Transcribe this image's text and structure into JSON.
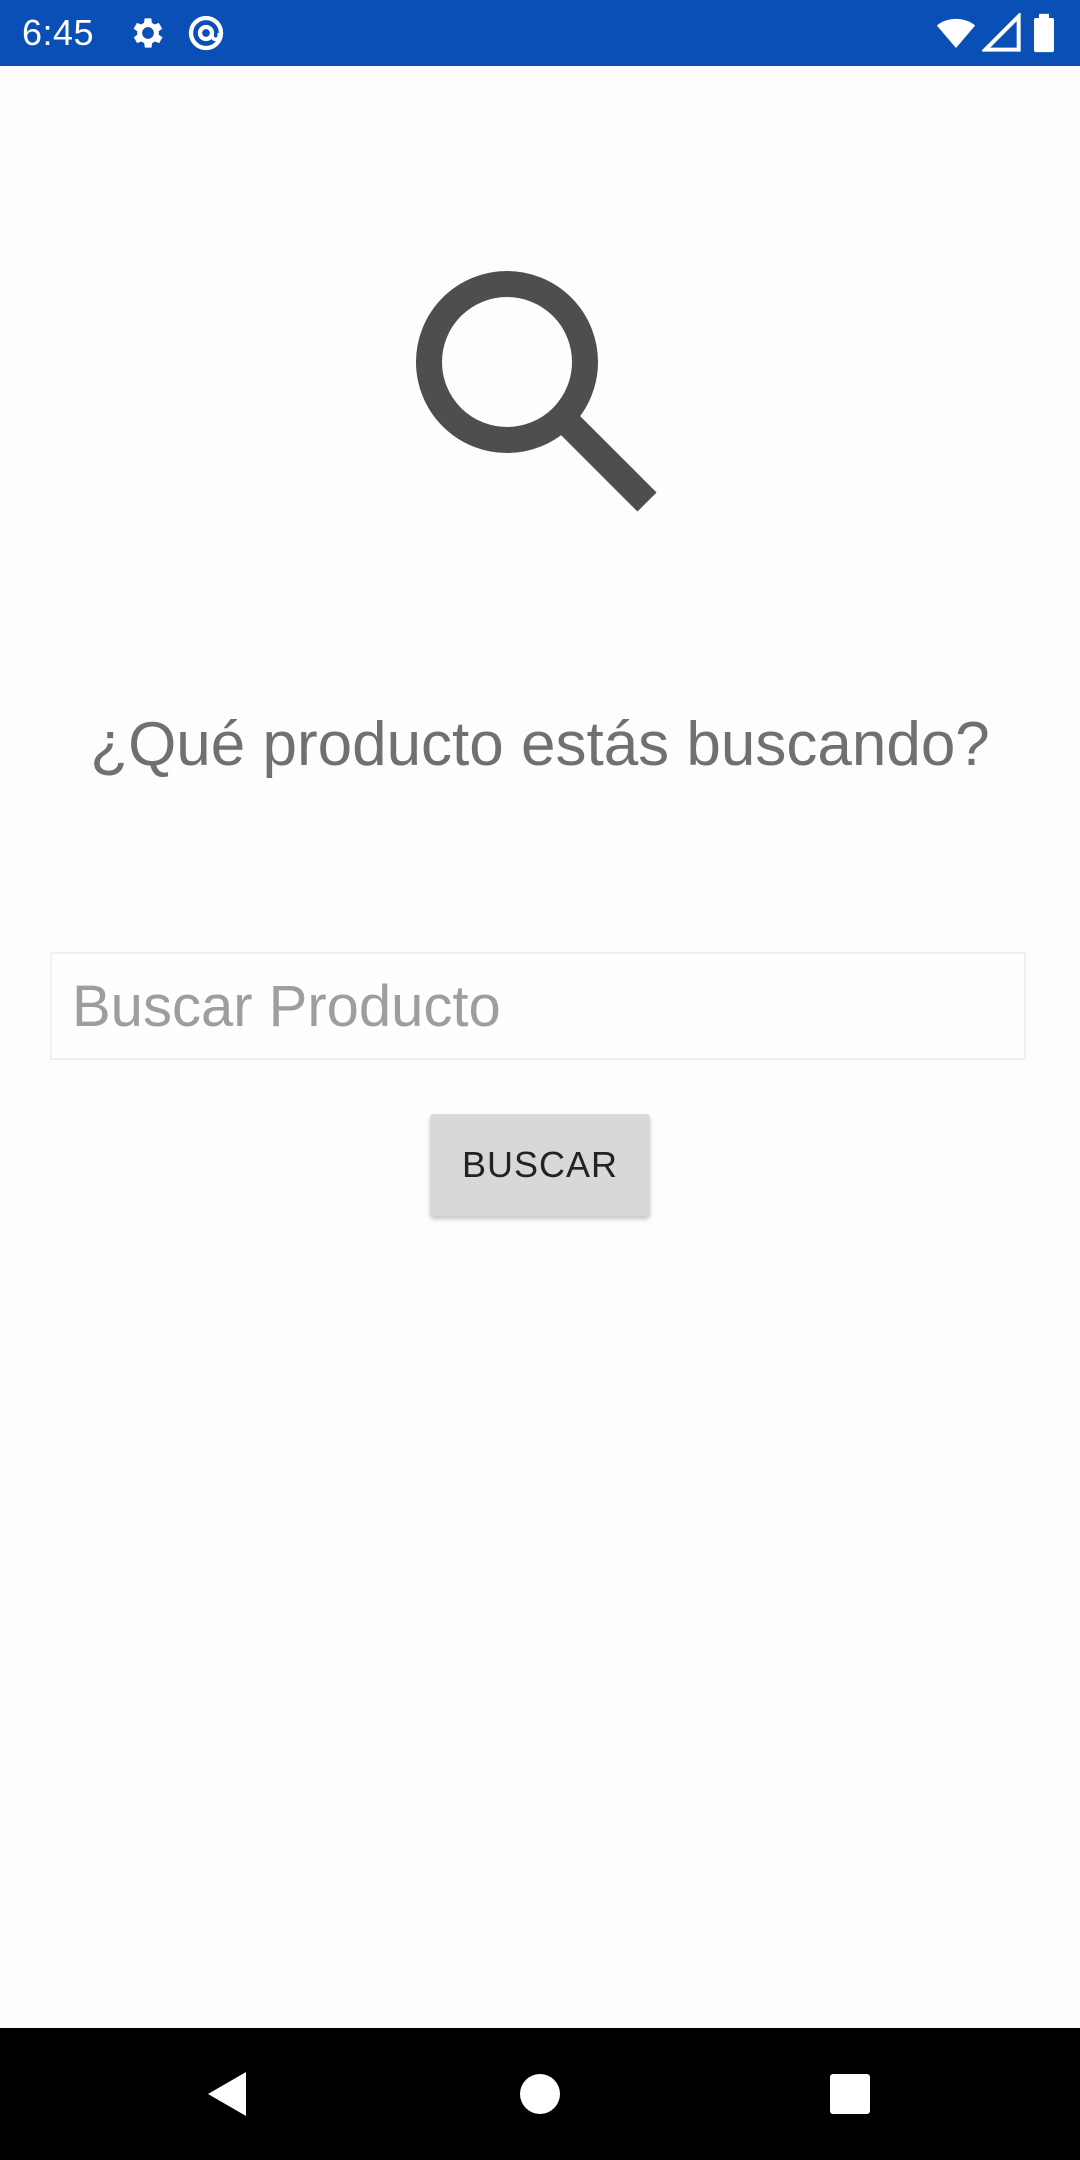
{
  "status_bar": {
    "time": "6:45",
    "background_color": "#0a4fb5",
    "left_icons": [
      "gear-icon",
      "at-sign-icon"
    ],
    "right_icons": [
      "wifi-icon",
      "cell-signal-icon",
      "battery-icon"
    ]
  },
  "main": {
    "hero_icon": "search-icon",
    "prompt": "¿Qué producto estás buscando?",
    "search_input": {
      "placeholder": "Buscar Producto",
      "value": ""
    },
    "search_button_label": "BUSCAR"
  },
  "nav_bar": {
    "buttons": [
      "back-icon",
      "home-icon",
      "recents-icon"
    ]
  }
}
